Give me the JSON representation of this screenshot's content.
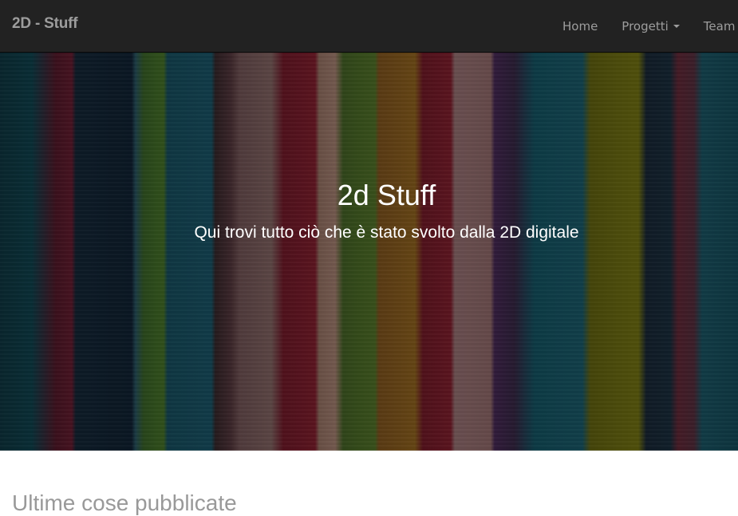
{
  "navbar": {
    "brand": "2D - Stuff",
    "items": [
      {
        "label": "Home"
      },
      {
        "label": "Progetti",
        "has_dropdown": true
      },
      {
        "label": "Team"
      }
    ]
  },
  "hero": {
    "title": "2d Stuff",
    "subtitle": "Qui trovi tutto ciò che è stato svolto dalla 2D digitale"
  },
  "main": {
    "section_title": "Ultime cose pubblicate"
  },
  "colors": {
    "navbar_bg": "#222222",
    "nav_text": "#9d9d9d",
    "hero_text": "#ffffff",
    "section_title": "#999999"
  }
}
